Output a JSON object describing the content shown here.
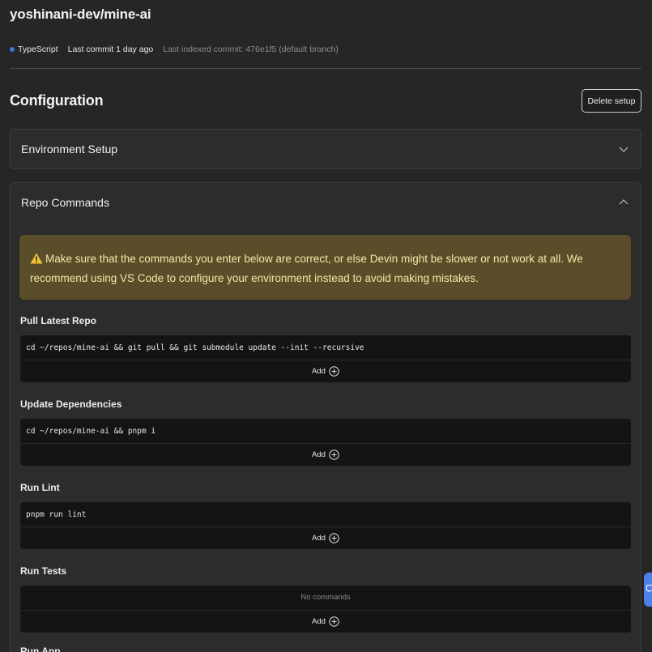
{
  "repo": {
    "title": "yoshinani-dev/mine-ai",
    "language": "TypeScript",
    "language_color": "#3a7bd5",
    "last_commit": "Last commit 1 day ago",
    "last_indexed": "Last indexed commit: 476e1f5 (default branch)"
  },
  "configuration": {
    "title": "Configuration",
    "delete_label": "Delete setup"
  },
  "environment_setup": {
    "label": "Environment Setup",
    "state_icon": "chevron-down-icon"
  },
  "repo_commands": {
    "label": "Repo Commands",
    "state_icon": "chevron-up-icon",
    "warning": "Make sure that the commands you enter below are correct, or else Devin might be slower or not work at all. We recommend using VS Code to configure your environment instead to avoid making mistakes.",
    "groups": [
      {
        "label": "Pull Latest Repo",
        "commands": [
          "cd ~/repos/mine-ai && git pull && git submodule update --init --recursive"
        ],
        "add_label": "Add"
      },
      {
        "label": "Update Dependencies",
        "commands": [
          "cd ~/repos/mine-ai && pnpm i"
        ],
        "add_label": "Add"
      },
      {
        "label": "Run Lint",
        "commands": [
          "pnpm run lint"
        ],
        "add_label": "Add"
      },
      {
        "label": "Run Tests",
        "commands": [],
        "empty_text": "No commands",
        "add_label": "Add"
      },
      {
        "label": "Run App"
      }
    ]
  },
  "colors": {
    "background": "#262626",
    "panel": "#2c2c2c",
    "warning_bg": "#5a4e2a",
    "warning_text": "#f3e7a8",
    "side_tab": "#4f7fe8"
  }
}
